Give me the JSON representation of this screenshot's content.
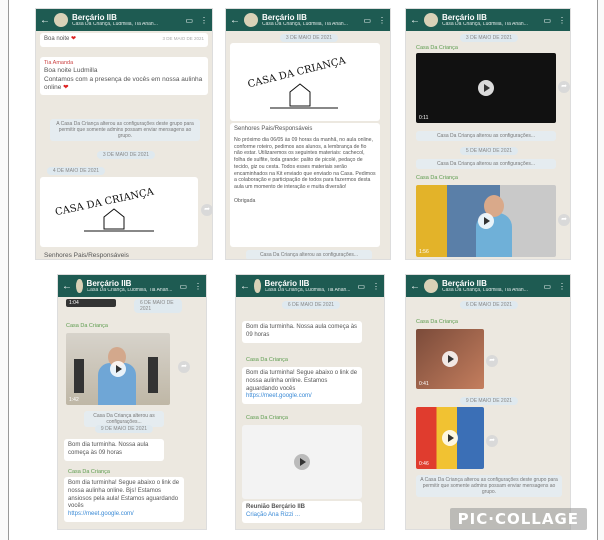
{
  "chat": {
    "title": "Berçário IIB",
    "subtitle": "Casa Da Criança, Ludmilla, Tia Anan..."
  },
  "panel1": {
    "msg_top": "Boa noite",
    "time_top": "3 DE MAIO DE 2021",
    "sender": "Tia Amanda",
    "msg_body_1": "Boa noite Ludmilla",
    "msg_body_2": "Contamos com a presença de vocês em nossa aulinha online",
    "system_notice": "A Casa Da Criança alterou as configurações deste grupo para permitir que somente admins possam enviar mensagens ao grupo.",
    "date_pill": "3 DE MAIO DE 2021",
    "date_pill_2": "4 DE MAIO DE 2021",
    "logo": "CASA DA CRIANÇA",
    "caption": "Senhores Pais/Responsáveis"
  },
  "panel2": {
    "date_pill": "3 DE MAIO DE 2021",
    "logo": "CASA DA CRIANÇA",
    "caption": "Senhores Pais/Responsáveis",
    "body": "No próximo dia 06/05 às 09 horas da manhã, no aula online, conforme roteiro, pedimos aos alunos, a lembrança de fio não estar. Utilizaremos os seguintes materiais: cachecol, folha de sulfite, toda grande: palito de picolé, pedaço de tecido, giz ou cesta. Todos esses materiais serão encaminhados na Kit enviado que enviado na Casa. Pedimos a colaboração e participação de todos para fazermos desta aula um momento de interação e muita diversão!",
    "sign": "Obrigada",
    "foot": "Casa Da Criança alterou as configurações..."
  },
  "panel3": {
    "date_pill": "3 DE MAIO DE 2021",
    "sender": "Casa Da Criança",
    "sys1": "Casa Da Criança alterou as configurações...",
    "date_pill_2": "5 DE MAIO DE 2021",
    "sys2": "Casa Da Criança alterou as configurações...",
    "sender2": "Casa Da Criança",
    "dur1": "0:11",
    "dur2": "1:56"
  },
  "panel4": {
    "dur_top": "1:04",
    "date_pill": "6 DE MAIO DE 2021",
    "sender": "Casa Da Criança",
    "dur": "1:42",
    "date_pill_2": "9 DE MAIO DE 2021",
    "sys": "Casa Da Criança alterou as configurações...",
    "msg1": "Bom dia turminha. Nossa aula começa às 09 horas",
    "sender2": "Casa Da Criança",
    "msg2": "Bom dia turminha! Segue abaixo o link de nossa aulinha online. Bjs! Estamos ansiosos pela aula! Estamos aguardando vocês",
    "link": "https://meet.google.com/"
  },
  "panel5": {
    "date_pill": "6 DE MAIO DE 2021",
    "msg1": "Bom dia turminha. Nossa aula começa às 09 horas",
    "sender": "Casa Da Criança",
    "msg2": "Bom dia turminha! Segue abaixo o link de nossa aulinha online. Estamos aguardando vocês",
    "link": "https://meet.google.com/",
    "sender2": "Casa Da Criança",
    "footer_title": "Reunião Berçário IIB",
    "footer_sub": "Criação Ana Rizzi ..."
  },
  "panel6": {
    "date_pill": "6 DE MAIO DE 2021",
    "sender": "Casa Da Criança",
    "dur1": "0:41",
    "date_pill_2": "9 DE MAIO DE 2021",
    "dur2": "0:46",
    "sys": "A Casa Da Criança alterou as configurações deste grupo para permitir que somente admins possam enviar mensagens ao grupo."
  },
  "watermark": "PIC·COLLAGE"
}
